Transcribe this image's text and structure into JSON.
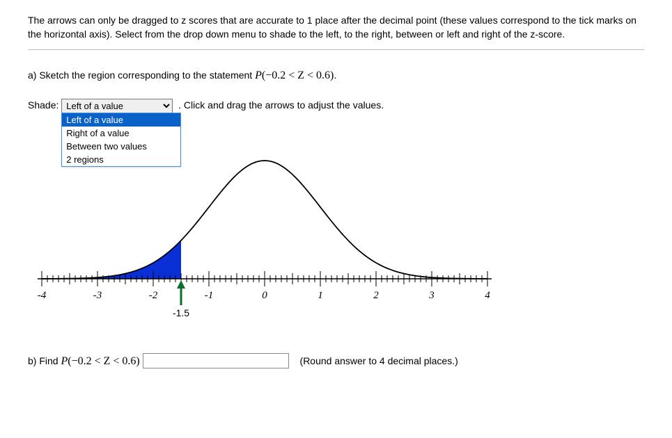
{
  "instructions": "The arrows can only be dragged to z scores that are accurate to 1 place after the decimal point (these values correspond to the tick marks on the horizontal axis). Select from the drop down menu to shade to the left, to the right, between or left and right of the z-score.",
  "partA": {
    "label": "a) Sketch the region corresponding to the statement ",
    "stmtPrefix": "P",
    "stmtInner": "(−0.2 < Z < 0.6)",
    "stmtSuffix": "."
  },
  "shade": {
    "label": "Shade:",
    "selected": "Left of a value",
    "options": [
      "Left of a value",
      "Right of a value",
      "Between two values",
      "2 regions"
    ],
    "after": ". Click and drag the arrows to adjust the values."
  },
  "chart_data": {
    "type": "line",
    "title": "",
    "xlabel": "",
    "ylabel": "",
    "xlim": [
      -4,
      4
    ],
    "ticks_major": [
      -4,
      -3,
      -2,
      -1,
      0,
      1,
      2,
      3,
      4
    ],
    "arrow_value": -1.5,
    "arrow_label": "-1.5",
    "shade": {
      "mode": "left",
      "to": -1.5
    },
    "curve_kind": "standard_normal"
  },
  "partB": {
    "label": "b) Find ",
    "stmtPrefix": "P",
    "stmtInner": "(−0.2 < Z < 0.6)",
    "answer": "",
    "roundNote": "(Round answer to 4 decimal places.)"
  }
}
